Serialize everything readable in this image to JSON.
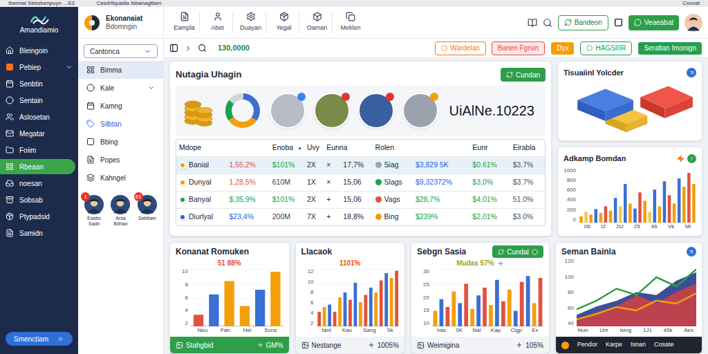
{
  "browser": {
    "tabs": [
      "Ibemial Sebsbenpuyn ...S3",
      "Cesd/Ibpadla Ibbanagtben"
    ],
    "user": "Cxooal"
  },
  "sidebar": {
    "brand": "Amandiamio",
    "items": [
      {
        "label": "Bleingoin",
        "selected": false,
        "expandable": false,
        "color": "#ffffff"
      },
      {
        "label": "Pebiep",
        "selected": false,
        "expandable": true,
        "color": "#f97316"
      },
      {
        "label": "Senbtin",
        "selected": false,
        "expandable": false,
        "color": "#ffffff"
      },
      {
        "label": "Sentain",
        "selected": false,
        "expandable": false,
        "color": "#ffffff"
      },
      {
        "label": "Aslosetan",
        "selected": false,
        "expandable": false,
        "color": "#ffffff"
      },
      {
        "label": "Megatar",
        "selected": false,
        "expandable": false,
        "color": "#ffffff"
      },
      {
        "label": "Foiim",
        "selected": false,
        "expandable": false,
        "color": "#ffffff"
      },
      {
        "label": "Rbeaan",
        "selected": true,
        "expandable": false,
        "color": "#ffffff"
      },
      {
        "label": "noesan",
        "selected": false,
        "expandable": false,
        "color": "#ffffff"
      },
      {
        "label": "Sobsab",
        "selected": false,
        "expandable": false,
        "color": "#ffffff"
      },
      {
        "label": "Ptypadsid",
        "selected": false,
        "expandable": false,
        "color": "#ffffff"
      },
      {
        "label": "Samidn",
        "selected": false,
        "expandable": false,
        "color": "#ffffff"
      }
    ],
    "footer_button": "Smenctiam"
  },
  "nav": {
    "brand": [
      "Ekonanaiat",
      "Bdomngin"
    ],
    "dropdown": "Cantonca",
    "items": [
      {
        "label": "Bimma",
        "selected": true,
        "expandable": false,
        "color": "#1f2937"
      },
      {
        "label": "Kale",
        "selected": false,
        "expandable": true,
        "color": "#1f2937"
      },
      {
        "label": "Kamng",
        "selected": false,
        "expandable": false,
        "color": "#1f2937"
      },
      {
        "label": "Silbtan",
        "selected": false,
        "expandable": false,
        "color": "#2563eb"
      },
      {
        "label": "Bbing",
        "selected": false,
        "expandable": false,
        "color": "#1f2937"
      },
      {
        "label": "Popes",
        "selected": false,
        "expandable": false,
        "color": "#1f2937"
      },
      {
        "label": "Kahngel",
        "selected": false,
        "expandable": false,
        "color": "#1f2937"
      }
    ],
    "people": [
      {
        "name": "Esebo Sadn",
        "badge": "1"
      },
      {
        "name": "Arsa Bdhan"
      },
      {
        "name": "Sebfiam",
        "badge": "61"
      }
    ]
  },
  "toolbar": {
    "tools": [
      "Eampla",
      "Abet",
      "Duayan",
      "Yegal",
      "Oaman",
      "Meklen"
    ],
    "buttons": [
      {
        "label": "Bandeon",
        "kind": "outline"
      },
      {
        "label": "Veaeabat",
        "kind": "filled"
      }
    ]
  },
  "filter_bar": {
    "value": "130,0000",
    "buttons": [
      {
        "label": "Wardelan",
        "kind": "outline",
        "color": "#f97316"
      },
      {
        "label": "Banen Fgrsin",
        "kind": "soft",
        "color": "#ef4444"
      },
      {
        "label": "Dyx",
        "kind": "filled",
        "color": "#f59e0b"
      },
      {
        "label": "HAGSIIIR",
        "kind": "outline",
        "color": "#16a34a"
      },
      {
        "label": "Seraltan Imonign",
        "kind": "filled",
        "color": "#22a04b"
      }
    ]
  },
  "main_card": {
    "title": "Nutagia Uhagin",
    "button": "Cundan",
    "code": "UiAlNe.10223",
    "donut": [
      {
        "value": 35,
        "color": "#3b6fd1"
      },
      {
        "value": 30,
        "color": "#f59e0b"
      },
      {
        "value": 20,
        "color": "#16a34a"
      },
      {
        "value": 15,
        "color": "#d1d5db"
      }
    ],
    "table": {
      "columns": [
        "Mdope",
        "Enoba",
        "Uvy",
        "Eunna",
        "Rolen",
        "Eunr",
        "Eirabla"
      ],
      "rows": [
        {
          "selected": true,
          "name": "Banial",
          "dot": "#f59e0b",
          "share": {
            "text": "1,55,2%",
            "color": "#e0533d"
          },
          "value": {
            "text": "$101%",
            "color": "#16a34a"
          },
          "mult": "2X",
          "sym": "×",
          "rate": "17,7%",
          "role": {
            "text": "Siag",
            "color": "#9ca3af"
          },
          "amount": {
            "text": "$3,829 5K",
            "color": "#2563eb"
          },
          "eunr": {
            "text": "$0.61%",
            "color": "#16a34a"
          },
          "eirabla": "$3.7%"
        },
        {
          "selected": false,
          "name": "Dunyal",
          "dot": "#f59e0b",
          "share": {
            "text": "1,28,5%",
            "color": "#e0533d"
          },
          "value": {
            "text": "610M",
            "color": "#374151"
          },
          "mult": "1X",
          "sym": "×",
          "rate": "15,06",
          "role": {
            "text": "Slags",
            "color": "#16a34a"
          },
          "amount": {
            "text": "$9,32372%",
            "color": "#2563eb"
          },
          "eunr": {
            "text": "$3,0%",
            "color": "#16a34a"
          },
          "eirabla": "$3.7%"
        },
        {
          "selected": false,
          "name": "Banyal",
          "dot": "#16a34a",
          "share": {
            "text": "$,35,9%",
            "color": "#16a34a"
          },
          "value": {
            "text": "$101%",
            "color": "#16a34a"
          },
          "mult": "2X",
          "sym": "+",
          "rate": "15,06",
          "role": {
            "text": "Vags",
            "color": "#e0533d"
          },
          "amount": {
            "text": "$28,7%",
            "color": "#16a34a"
          },
          "eunr": {
            "text": "$4,01%",
            "color": "#16a34a"
          },
          "eirabla": "51.0%"
        },
        {
          "selected": false,
          "name": "Diurlyal",
          "dot": "#2563eb",
          "share": {
            "text": "$23,4%",
            "color": "#2563eb"
          },
          "value": {
            "text": "200M",
            "color": "#374151"
          },
          "mult": "7X",
          "sym": "+",
          "rate": "18,8%",
          "role": {
            "text": "Bing",
            "color": "#f59e0b"
          },
          "amount": {
            "text": "$239%",
            "color": "#16a34a"
          },
          "eunr": {
            "text": "$2,01%",
            "color": "#16a34a"
          },
          "eirabla": "$3.0%"
        }
      ]
    }
  },
  "right_cards": {
    "blocks_title": "Tisuaiinl Yolcder",
    "chart_card": {
      "title": "Adkamp Bomdan",
      "ticks": [
        "1000",
        "800",
        "600",
        "400",
        "200",
        "0"
      ],
      "labels": [
        "06",
        "I2",
        "2U",
        "25",
        "46",
        "Vk",
        "Ml"
      ],
      "bars": [
        {
          "value": 120,
          "color": "#f59e0b"
        },
        {
          "value": 200,
          "color": "#f2c94c"
        },
        {
          "value": 150,
          "color": "#f59e0b"
        },
        {
          "value": 250,
          "color": "#3b6fd1"
        },
        {
          "value": 180,
          "color": "#f59e0b"
        },
        {
          "value": 300,
          "color": "#e0533d"
        },
        {
          "value": 220,
          "color": "#f59e0b"
        },
        {
          "value": 450,
          "color": "#3b6fd1"
        },
        {
          "value": 300,
          "color": "#f2c94c"
        },
        {
          "value": 700,
          "color": "#3b6fd1"
        },
        {
          "value": 350,
          "color": "#f59e0b"
        },
        {
          "value": 260,
          "color": "#3b6fd1"
        },
        {
          "value": 550,
          "color": "#e0533d"
        },
        {
          "value": 400,
          "color": "#f59e0b"
        },
        {
          "value": 200,
          "color": "#f2c94c"
        },
        {
          "value": 600,
          "color": "#3b6fd1"
        },
        {
          "value": 300,
          "color": "#f59e0b"
        },
        {
          "value": 750,
          "color": "#3b6fd1"
        },
        {
          "value": 500,
          "color": "#e0533d"
        },
        {
          "value": 350,
          "color": "#f59e0b"
        },
        {
          "value": 800,
          "color": "#3b6fd1"
        },
        {
          "value": 650,
          "color": "#f59e0b"
        },
        {
          "value": 900,
          "color": "#e0533d"
        },
        {
          "value": 700,
          "color": "#f59e0b"
        }
      ]
    }
  },
  "bottom_cards": [
    {
      "title": "Konanat Romuken",
      "subtitle": {
        "text": "51 88%",
        "color": "#e0533d"
      },
      "chart": {
        "kind": "bar",
        "ticks": [
          "10",
          "8",
          "6",
          "4",
          "2"
        ],
        "labels": [
          "Neu",
          "Fan",
          "Hel",
          "Scns"
        ],
        "bars": [
          {
            "value": 2,
            "color": "#e0533d"
          },
          {
            "value": 5.5,
            "color": "#3b6fd1"
          },
          {
            "value": 7.8,
            "color": "#f59e0b"
          },
          {
            "value": 3.5,
            "color": "#f59e0b"
          },
          {
            "value": 6.3,
            "color": "#3b6fd1"
          },
          {
            "value": 9.4,
            "color": "#f59e0b"
          }
        ]
      },
      "footer": {
        "kind": "green",
        "label": "Stahgbid",
        "value": "GM%"
      }
    },
    {
      "title": "Llacaok",
      "subtitle": {
        "text": "1101%",
        "color": "#ea580c"
      },
      "chart": {
        "kind": "bar",
        "ticks": [
          "12",
          "10",
          "8",
          "6",
          "4",
          "2"
        ],
        "labels": [
          "fant",
          "Kau",
          "Sang",
          "Sk"
        ],
        "bars": [
          {
            "value": 3,
            "color": "#e0533d"
          },
          {
            "value": 4,
            "color": "#f59e0b"
          },
          {
            "value": 4.5,
            "color": "#3b6fd1"
          },
          {
            "value": 3,
            "color": "#e0533d"
          },
          {
            "value": 6,
            "color": "#f59e0b"
          },
          {
            "value": 7,
            "color": "#3b6fd1"
          },
          {
            "value": 5.5,
            "color": "#e0533d"
          },
          {
            "value": 9,
            "color": "#3b6fd1"
          },
          {
            "value": 5,
            "color": "#f59e0b"
          },
          {
            "value": 6.5,
            "color": "#e0533d"
          },
          {
            "value": 8,
            "color": "#3b6fd1"
          },
          {
            "value": 7,
            "color": "#f59e0b"
          },
          {
            "value": 9.5,
            "color": "#e0533d"
          },
          {
            "value": 11,
            "color": "#3b6fd1"
          },
          {
            "value": 10,
            "color": "#f59e0b"
          },
          {
            "value": 11.5,
            "color": "#e0533d"
          }
        ]
      },
      "footer": {
        "kind": "light",
        "label": "Nestange",
        "value": "1005%"
      }
    },
    {
      "title": "Sebgn Sasia",
      "button": "Cundal",
      "subtitle": {
        "text": "Mudas 57%",
        "color": "#a3a322"
      },
      "chart": {
        "kind": "bar",
        "ticks": [
          "30",
          "25",
          "20",
          "15",
          "10"
        ],
        "labels": [
          "has",
          "0K",
          "Nal",
          "Kap",
          "Cigp",
          "Ex"
        ],
        "bars": [
          {
            "value": 8,
            "color": "#f59e0b"
          },
          {
            "value": 14,
            "color": "#3b6fd1"
          },
          {
            "value": 10,
            "color": "#e0533d"
          },
          {
            "value": 18,
            "color": "#f59e0b"
          },
          {
            "value": 12,
            "color": "#3b6fd1"
          },
          {
            "value": 22,
            "color": "#e0533d"
          },
          {
            "value": 9,
            "color": "#f59e0b"
          },
          {
            "value": 16,
            "color": "#3b6fd1"
          },
          {
            "value": 20,
            "color": "#e0533d"
          },
          {
            "value": 11,
            "color": "#f59e0b"
          },
          {
            "value": 24,
            "color": "#3b6fd1"
          },
          {
            "value": 13,
            "color": "#e0533d"
          },
          {
            "value": 19,
            "color": "#f59e0b"
          },
          {
            "value": 8,
            "color": "#3b6fd1"
          },
          {
            "value": 23,
            "color": "#e0533d"
          },
          {
            "value": 26,
            "color": "#3b6fd1"
          },
          {
            "value": 12,
            "color": "#f59e0b"
          },
          {
            "value": 25,
            "color": "#e0533d"
          }
        ]
      },
      "footer": {
        "kind": "light",
        "label": "Weimigina",
        "value": "105%"
      }
    },
    {
      "title": "Seman Bainla",
      "chart": {
        "kind": "area",
        "ticks": [
          "120",
          "100",
          "80",
          "60",
          "40"
        ],
        "labels": [
          "Nun",
          "Um",
          "Ising",
          "1J1",
          "45k",
          "Aex"
        ],
        "series": [
          {
            "kind": "area",
            "color": "#2b3f8f",
            "values": [
              20,
              35,
              45,
              60,
              55,
              80,
              95
            ]
          },
          {
            "kind": "area",
            "color": "#c9414a",
            "values": [
              10,
              25,
              35,
              55,
              40,
              60,
              75
            ]
          },
          {
            "kind": "line",
            "color": "#f59e0b",
            "values": [
              12,
              22,
              34,
              28,
              45,
              40,
              58
            ]
          },
          {
            "kind": "line",
            "color": "#2e9e48",
            "values": [
              30,
              45,
              66,
              55,
              86,
              70,
              100
            ]
          }
        ]
      },
      "footer": {
        "kind": "dark",
        "items": [
          "Pendor",
          "Karpe",
          "Isnan",
          "Cosate"
        ]
      }
    }
  ]
}
